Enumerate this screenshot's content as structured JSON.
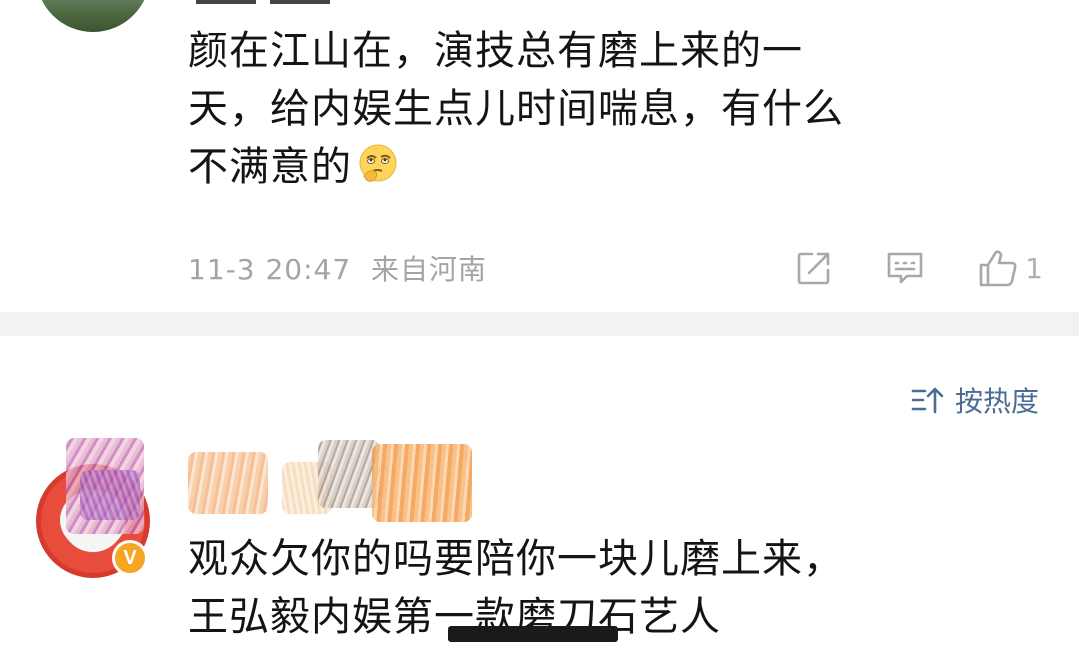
{
  "comment1": {
    "lines": [
      "颜在江山在，演技总有磨上来的一",
      "天，给内娱生点儿时间喘息，有什么",
      "不满意的"
    ],
    "emoji_icon": "thinking-eyeroll-emoji",
    "timestamp": "11-3 20:47",
    "location": "来自河南",
    "like_count": "1",
    "icons": [
      "share-icon",
      "comment-icon",
      "thumbs-up-icon"
    ]
  },
  "sort": {
    "label": "按热度",
    "icon": "sort-icon"
  },
  "comment2": {
    "lines": [
      "观众欠你的吗要陪你一块儿磨上来，",
      "王弘毅内娱第一款磨刀石艺人"
    ],
    "verified_badge": "V"
  },
  "colors": {
    "text": "#141414",
    "meta": "#a4a4a4",
    "link": "#4a6c95",
    "divider": "#f2f2f2",
    "badge": "#f5a623"
  }
}
